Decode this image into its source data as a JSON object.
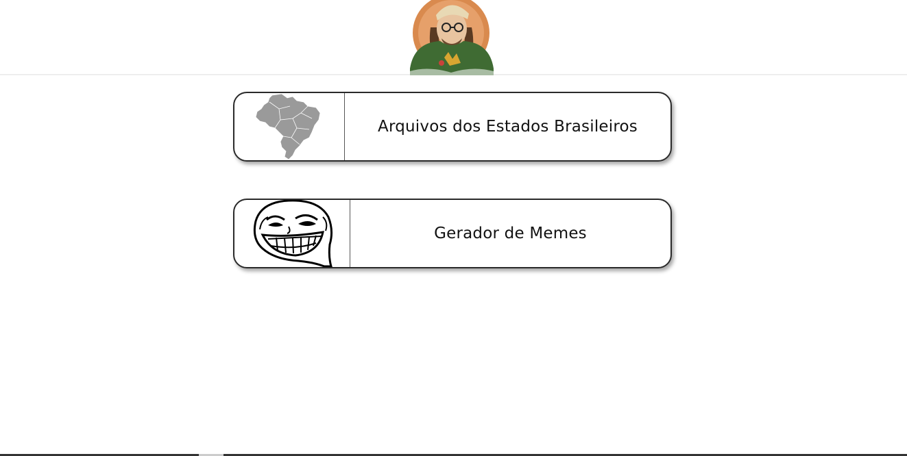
{
  "header": {
    "avatar_icon": "illustrated-avatar-icon"
  },
  "cards": [
    {
      "label": "Arquivos dos Estados Brasileiros",
      "icon": "brazil-map-icon"
    },
    {
      "label": "Gerador de Memes",
      "icon": "trollface-icon"
    }
  ],
  "colors": {
    "card_border": "#2a2a2a",
    "map_fill": "#9a9a9a",
    "header_divider": "#eeeeee",
    "avatar_shirt": "#3f6b33",
    "avatar_bg": "#d98a4e"
  }
}
